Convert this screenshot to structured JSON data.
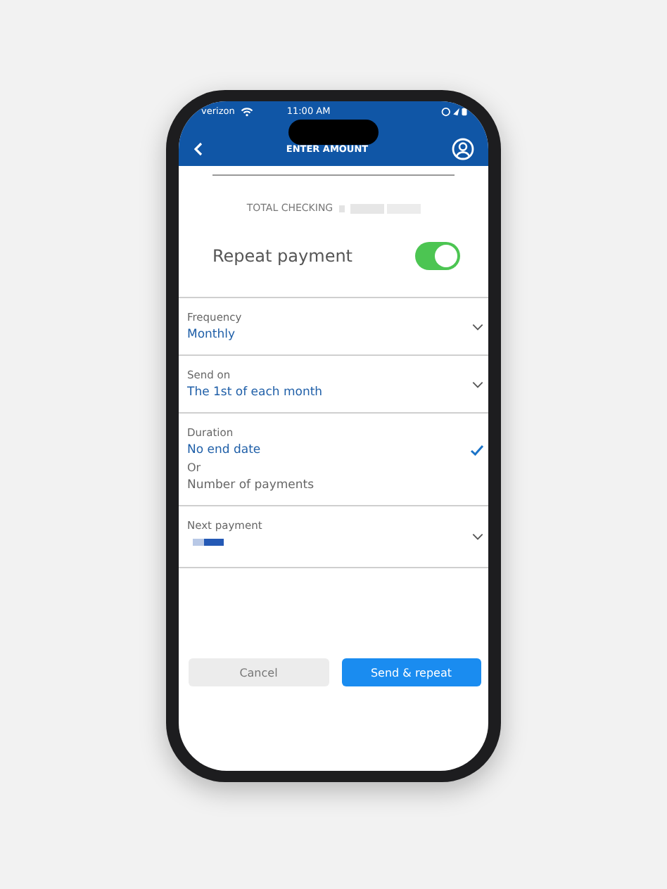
{
  "status_bar": {
    "carrier": "verizon",
    "time": "11:00 AM"
  },
  "header": {
    "title": "ENTER AMOUNT"
  },
  "account": {
    "label": "TOTAL CHECKING"
  },
  "repeat": {
    "label": "Repeat payment",
    "on": true
  },
  "fields": [
    {
      "kind": "dropdown",
      "label": "Frequency",
      "value": "Monthly"
    },
    {
      "kind": "dropdown",
      "label": "Send on",
      "value": "The 1st of each month"
    },
    {
      "kind": "options",
      "label": "Duration",
      "options": [
        {
          "label": "No end date",
          "selected": true
        },
        {
          "label": "Number of payments",
          "selected": false
        }
      ],
      "separator": "Or"
    },
    {
      "kind": "hidden",
      "label": "Next payment"
    }
  ],
  "buttons": [
    {
      "label": "Cancel",
      "kind": "secondary"
    },
    {
      "label": "Send & repeat",
      "kind": "primary"
    }
  ]
}
